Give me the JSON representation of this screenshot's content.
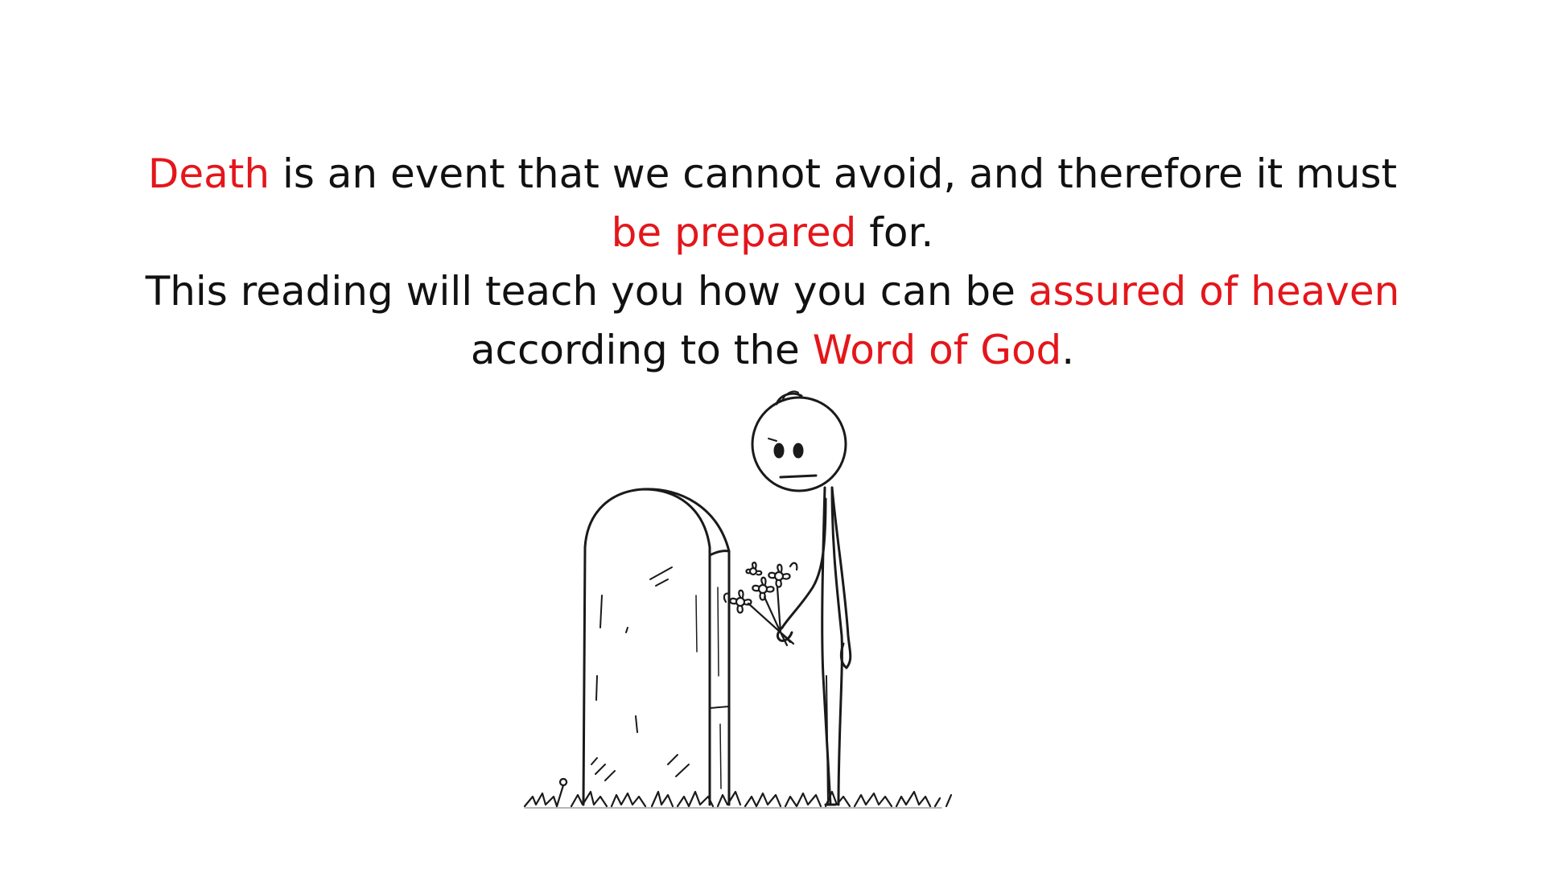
{
  "colors": {
    "text": "#111111",
    "highlight": "#e4161b",
    "background": "#ffffff",
    "ink": "#1a1a1a"
  },
  "intro": {
    "s1_highlight": "Death",
    "s1_text": " is an event that we cannot avoid, and therefore it must ",
    "s1_highlight2": "be prepared",
    "s1_end": " for.",
    "s2_text": "This reading will teach you how you can be ",
    "s2_highlight": "assured of heaven",
    "s2_text2": " according to the ",
    "s2_highlight2": "Word of God",
    "s2_end": "."
  },
  "illustration": {
    "icons": [
      "tombstone-icon",
      "stick-figure-icon",
      "flower-bouquet-icon",
      "grass-icon"
    ]
  }
}
